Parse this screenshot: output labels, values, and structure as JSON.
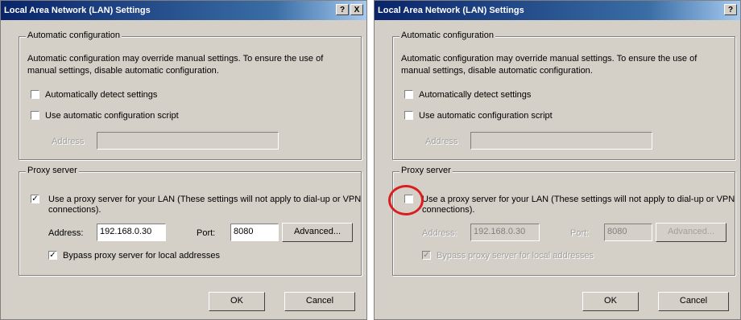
{
  "dialog": {
    "title": "Local Area Network (LAN) Settings",
    "help_button": "?",
    "close_button": "X",
    "auto_config": {
      "legend": "Automatic configuration",
      "description": "Automatic configuration may override manual settings.  To ensure the use of manual settings, disable automatic configuration.",
      "detect_label": "Automatically detect settings",
      "script_label": "Use automatic configuration script",
      "address_label": "Address"
    },
    "proxy": {
      "legend": "Proxy server",
      "use_proxy_label": "Use a proxy server for your LAN (These settings will not apply to dial-up or VPN connections).",
      "address_label": "Address:",
      "address_value": "192.168.0.30",
      "port_label": "Port:",
      "port_value": "8080",
      "advanced_label": "Advanced...",
      "bypass_label": "Bypass proxy server for local addresses"
    },
    "ok_label": "OK",
    "cancel_label": "Cancel"
  },
  "state": {
    "left": {
      "detect_checked": false,
      "script_checked": false,
      "use_proxy_checked": true,
      "bypass_checked": true,
      "proxy_enabled": true
    },
    "right": {
      "detect_checked": false,
      "script_checked": false,
      "use_proxy_checked": false,
      "bypass_checked": true,
      "proxy_enabled": false
    }
  },
  "highlight": {
    "color": "#d81e1e",
    "target": "right use-proxy checkbox"
  }
}
